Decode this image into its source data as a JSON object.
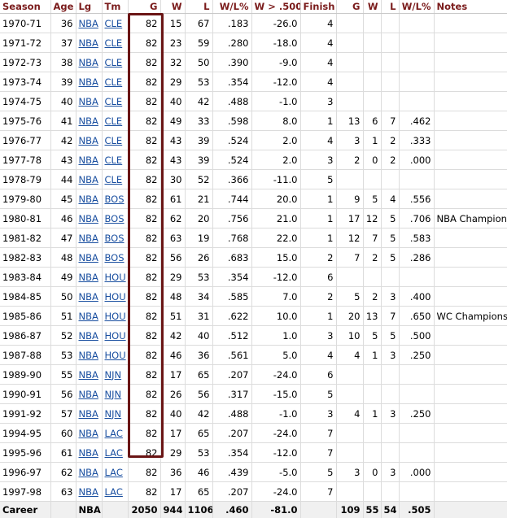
{
  "headers": [
    "Season",
    "Age",
    "Lg",
    "Tm",
    "G",
    "W",
    "L",
    "W/L%",
    "W > .500",
    "Finish",
    "G",
    "W",
    "L",
    "W/L%",
    "Notes"
  ],
  "rows": [
    {
      "season": "1970-71",
      "age": "36",
      "lg": "NBA",
      "tm": "CLE",
      "g": "82",
      "w": "15",
      "l": "67",
      "wl": "",
      ".183": "",
      "wl_pct": ".183",
      "w500": "-26.0",
      "finish": "4",
      "pg": "",
      "pw": "",
      "pl": "",
      "pwl": "",
      "notes": ""
    },
    {
      "season": "1971-72",
      "age": "37",
      "lg": "NBA",
      "tm": "CLE",
      "g": "82",
      "w": "23",
      "l": "59",
      "wl_pct": ".280",
      "w500": "-18.0",
      "finish": "4",
      "pg": "",
      "pw": "",
      "pl": "",
      "pwl": "",
      "notes": ""
    },
    {
      "season": "1972-73",
      "age": "38",
      "lg": "NBA",
      "tm": "CLE",
      "g": "82",
      "w": "32",
      "l": "50",
      "wl_pct": ".390",
      "w500": "-9.0",
      "finish": "4",
      "pg": "",
      "pw": "",
      "pl": "",
      "pwl": "",
      "notes": ""
    },
    {
      "season": "1973-74",
      "age": "39",
      "lg": "NBA",
      "tm": "CLE",
      "g": "82",
      "w": "29",
      "l": "53",
      "wl_pct": ".354",
      "w500": "-12.0",
      "finish": "4",
      "pg": "",
      "pw": "",
      "pl": "",
      "pwl": "",
      "notes": ""
    },
    {
      "season": "1974-75",
      "age": "40",
      "lg": "NBA",
      "tm": "CLE",
      "g": "82",
      "w": "40",
      "l": "42",
      "wl_pct": ".488",
      "w500": "-1.0",
      "finish": "3",
      "pg": "",
      "pw": "",
      "pl": "",
      "pwl": "",
      "notes": ""
    },
    {
      "season": "1975-76",
      "age": "41",
      "lg": "NBA",
      "tm": "CLE",
      "g": "82",
      "w": "49",
      "l": "33",
      "wl_pct": ".598",
      "w500": "8.0",
      "finish": "1",
      "pg": "13",
      "pw": "6",
      "pl": "7",
      "pwl": ".462",
      "notes": ""
    },
    {
      "season": "1976-77",
      "age": "42",
      "lg": "NBA",
      "tm": "CLE",
      "g": "82",
      "w": "43",
      "l": "39",
      "wl_pct": ".524",
      "w500": "2.0",
      "finish": "4",
      "pg": "3",
      "pw": "1",
      "pl": "2",
      "pwl": ".333",
      "notes": ""
    },
    {
      "season": "1977-78",
      "age": "43",
      "lg": "NBA",
      "tm": "CLE",
      "g": "82",
      "w": "43",
      "l": "39",
      "wl_pct": ".524",
      "w500": "2.0",
      "finish": "3",
      "pg": "2",
      "pw": "0",
      "pl": "2",
      "pwl": ".000",
      "notes": ""
    },
    {
      "season": "1978-79",
      "age": "44",
      "lg": "NBA",
      "tm": "CLE",
      "g": "82",
      "w": "30",
      "l": "52",
      "wl_pct": ".366",
      "w500": "-11.0",
      "finish": "5",
      "pg": "",
      "pw": "",
      "pl": "",
      "pwl": "",
      "notes": ""
    },
    {
      "season": "1979-80",
      "age": "45",
      "lg": "NBA",
      "tm": "BOS",
      "g": "82",
      "w": "61",
      "l": "21",
      "wl_pct": ".744",
      "w500": "20.0",
      "finish": "1",
      "pg": "9",
      "pw": "5",
      "pl": "4",
      "pwl": ".556",
      "notes": ""
    },
    {
      "season": "1980-81",
      "age": "46",
      "lg": "NBA",
      "tm": "BOS",
      "g": "82",
      "w": "62",
      "l": "20",
      "wl_pct": ".756",
      "w500": "21.0",
      "finish": "1",
      "pg": "17",
      "pw": "12",
      "pl": "5",
      "pwl": ".706",
      "notes": "NBA Champions"
    },
    {
      "season": "1981-82",
      "age": "47",
      "lg": "NBA",
      "tm": "BOS",
      "g": "82",
      "w": "63",
      "l": "19",
      "wl_pct": ".768",
      "w500": "22.0",
      "finish": "1",
      "pg": "12",
      "pw": "7",
      "pl": "5",
      "pwl": ".583",
      "notes": ""
    },
    {
      "season": "1982-83",
      "age": "48",
      "lg": "NBA",
      "tm": "BOS",
      "g": "82",
      "w": "56",
      "l": "26",
      "wl_pct": ".683",
      "w500": "15.0",
      "finish": "2",
      "pg": "7",
      "pw": "2",
      "pl": "5",
      "pwl": ".286",
      "notes": ""
    },
    {
      "season": "1983-84",
      "age": "49",
      "lg": "NBA",
      "tm": "HOU",
      "g": "82",
      "w": "29",
      "l": "53",
      "wl_pct": ".354",
      "w500": "-12.0",
      "finish": "6",
      "pg": "",
      "pw": "",
      "pl": "",
      "pwl": "",
      "notes": ""
    },
    {
      "season": "1984-85",
      "age": "50",
      "lg": "NBA",
      "tm": "HOU",
      "g": "82",
      "w": "48",
      "l": "34",
      "wl_pct": ".585",
      "w500": "7.0",
      "finish": "2",
      "pg": "5",
      "pw": "2",
      "pl": "3",
      "pwl": ".400",
      "notes": ""
    },
    {
      "season": "1985-86",
      "age": "51",
      "lg": "NBA",
      "tm": "HOU",
      "g": "82",
      "w": "51",
      "l": "31",
      "wl_pct": ".622",
      "w500": "10.0",
      "finish": "1",
      "pg": "20",
      "pw": "13",
      "pl": "7",
      "pwl": ".650",
      "notes": "WC Champions"
    },
    {
      "season": "1986-87",
      "age": "52",
      "lg": "NBA",
      "tm": "HOU",
      "g": "82",
      "w": "42",
      "l": "40",
      "wl_pct": ".512",
      "w500": "1.0",
      "finish": "3",
      "pg": "10",
      "pw": "5",
      "pl": "5",
      "pwl": ".500",
      "notes": ""
    },
    {
      "season": "1987-88",
      "age": "53",
      "lg": "NBA",
      "tm": "HOU",
      "g": "82",
      "w": "46",
      "l": "36",
      "wl_pct": ".561",
      "w500": "5.0",
      "finish": "4",
      "pg": "4",
      "pw": "1",
      "pl": "3",
      "pwl": ".250",
      "notes": ""
    },
    {
      "season": "1989-90",
      "age": "55",
      "lg": "NBA",
      "tm": "NJN",
      "g": "82",
      "w": "17",
      "l": "65",
      "wl_pct": ".207",
      "w500": "-24.0",
      "finish": "6",
      "pg": "",
      "pw": "",
      "pl": "",
      "pwl": "",
      "notes": ""
    },
    {
      "season": "1990-91",
      "age": "56",
      "lg": "NBA",
      "tm": "NJN",
      "g": "82",
      "w": "26",
      "l": "56",
      "wl_pct": ".317",
      "w500": "-15.0",
      "finish": "5",
      "pg": "",
      "pw": "",
      "pl": "",
      "pwl": "",
      "notes": ""
    },
    {
      "season": "1991-92",
      "age": "57",
      "lg": "NBA",
      "tm": "NJN",
      "g": "82",
      "w": "40",
      "l": "42",
      "wl_pct": ".488",
      "w500": "-1.0",
      "finish": "3",
      "pg": "4",
      "pw": "1",
      "pl": "3",
      "pwl": ".250",
      "notes": ""
    },
    {
      "season": "1994-95",
      "age": "60",
      "lg": "NBA",
      "tm": "LAC",
      "g": "82",
      "w": "17",
      "l": "65",
      "wl_pct": ".207",
      "w500": "-24.0",
      "finish": "7",
      "pg": "",
      "pw": "",
      "pl": "",
      "pwl": "",
      "notes": ""
    },
    {
      "season": "1995-96",
      "age": "61",
      "lg": "NBA",
      "tm": "LAC",
      "g": "82",
      "w": "29",
      "l": "53",
      "wl_pct": ".354",
      "w500": "-12.0",
      "finish": "7",
      "pg": "",
      "pw": "",
      "pl": "",
      "pwl": "",
      "notes": ""
    },
    {
      "season": "1996-97",
      "age": "62",
      "lg": "NBA",
      "tm": "LAC",
      "g": "82",
      "w": "36",
      "l": "46",
      "wl_pct": ".439",
      "w500": "-5.0",
      "finish": "5",
      "pg": "3",
      "pw": "0",
      "pl": "3",
      "pwl": ".000",
      "notes": ""
    },
    {
      "season": "1997-98",
      "age": "63",
      "lg": "NBA",
      "tm": "LAC",
      "g": "82",
      "w": "17",
      "l": "65",
      "wl_pct": ".207",
      "w500": "-24.0",
      "finish": "7",
      "pg": "",
      "pw": "",
      "pl": "",
      "pwl": "",
      "notes": ""
    }
  ],
  "career": {
    "season": "Career",
    "age": "",
    "lg": "NBA",
    "tm": "",
    "g": "2050",
    "w": "944",
    "l": "1106",
    "wl_pct": ".460",
    "w500": "-81.0",
    "finish": "",
    "pg": "109",
    "pw": "55",
    "pl": "54",
    "pwl": ".505",
    "notes": ""
  },
  "colors": {
    "header_text": "#7a1b1b",
    "link": "#1a4fa0",
    "highlight_border": "#6a1515",
    "footer_bg": "#f0f0f0"
  }
}
